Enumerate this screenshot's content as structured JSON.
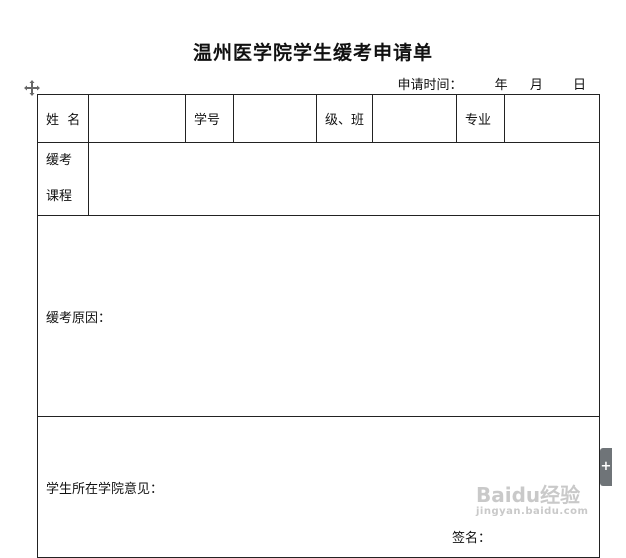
{
  "title": "温州医学院学生缓考申请单",
  "date_line": {
    "label": "申请时间：",
    "year": "年",
    "month": "月",
    "day": "日"
  },
  "row1": {
    "name_label": "姓  名",
    "student_id_label": "学号",
    "class_label": "级、班",
    "major_label": "专业"
  },
  "row2": {
    "course_label_line1": "缓考",
    "course_label_line2": "课程"
  },
  "reason_label": "缓考原因：",
  "opinion_label": "学生所在学院意见：",
  "signature_label": "签名：",
  "side_tab": "+",
  "watermark": {
    "brand": "Baidu经验",
    "url": "jingyan.baidu.com"
  }
}
